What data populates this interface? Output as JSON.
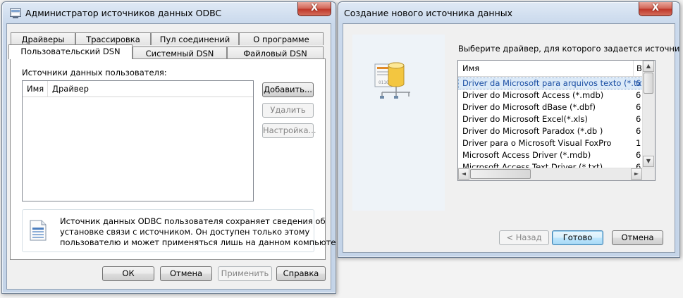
{
  "odbc_window": {
    "title": "Администратор источников данных ODBC",
    "close": "X",
    "tabs_top": [
      "Драйверы",
      "Трассировка",
      "Пул соединений",
      "О программе"
    ],
    "tabs_bottom": [
      "Пользовательский DSN",
      "Системный DSN",
      "Файловый DSN"
    ],
    "sources_label": "Источники данных пользователя:",
    "columns": [
      "Имя",
      "Драйвер"
    ],
    "add_button": "Добавить...",
    "remove_button": "Удалить",
    "configure_button": "Настройка...",
    "info_text_1": "Источник данных ODBC пользователя сохраняет сведения об",
    "info_text_2": "установке связи с источником.  Он доступен только этому",
    "info_text_3": "пользователю и может применяться лишь на данном компьютере.",
    "ok_button": "ОК",
    "cancel_button": "Отмена",
    "apply_button": "Применить",
    "help_button": "Справка"
  },
  "new_source_window": {
    "title": "Создание нового источника данных",
    "close": "X",
    "prompt": "Выберите драйвер, для которого задается источник.",
    "columns": [
      "Имя",
      "В"
    ],
    "drivers": [
      {
        "name": "Driver da Microsoft para arquivos texto (*.txt; *.csv)",
        "version": "6",
        "selected": true
      },
      {
        "name": "Driver do Microsoft Access (*.mdb)",
        "version": "6",
        "selected": false
      },
      {
        "name": "Driver do Microsoft dBase (*.dbf)",
        "version": "6",
        "selected": false
      },
      {
        "name": "Driver do Microsoft Excel(*.xls)",
        "version": "6",
        "selected": false
      },
      {
        "name": "Driver do Microsoft Paradox (*.db )",
        "version": "6",
        "selected": false
      },
      {
        "name": "Driver para o Microsoft Visual FoxPro",
        "version": "1",
        "selected": false
      },
      {
        "name": "Microsoft Access Driver (*.mdb)",
        "version": "6",
        "selected": false
      },
      {
        "name": "Microsoft Access Text Driver (*.txt)",
        "version": "6",
        "selected": false
      }
    ],
    "back_button": "< Назад",
    "finish_button": "Готово",
    "cancel_button": "Отмена"
  }
}
